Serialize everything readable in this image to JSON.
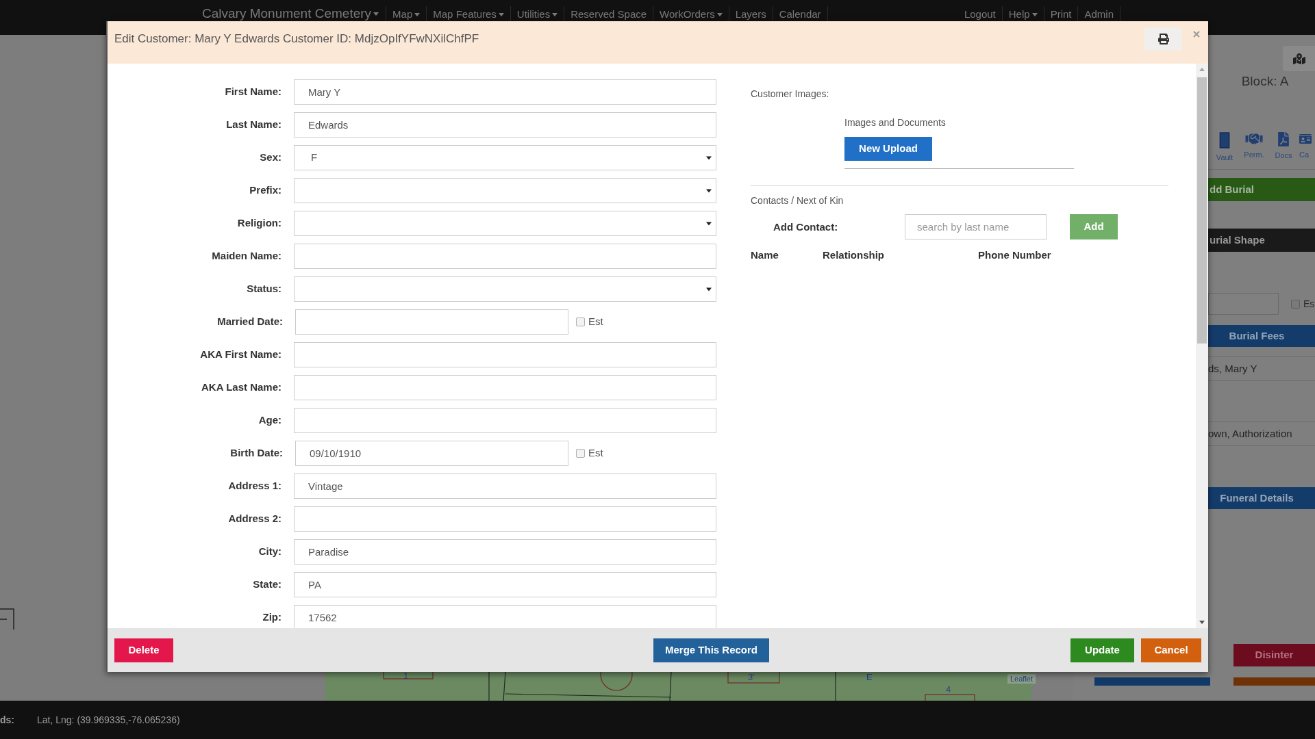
{
  "nav": {
    "brand": {
      "label": "Calvary Monument Cemetery",
      "caret": true
    },
    "items": [
      {
        "label": "Map",
        "caret": true
      },
      {
        "label": "Map Features",
        "caret": true
      },
      {
        "label": "Utilities",
        "caret": true
      },
      {
        "label": "Reserved Space",
        "caret": false
      },
      {
        "label": "WorkOrders",
        "caret": true
      },
      {
        "label": "Layers",
        "caret": false
      },
      {
        "label": "Calendar",
        "caret": false
      }
    ],
    "right_items": [
      {
        "label": "Logout",
        "caret": false
      },
      {
        "label": "Help",
        "caret": true
      },
      {
        "label": "Print",
        "caret": false
      },
      {
        "label": "Admin",
        "caret": false
      }
    ]
  },
  "modal": {
    "title": "Edit Customer: Mary Y Edwards Customer ID: MdjzOpIfYFwNXilChfPF",
    "fields": [
      {
        "kind": "text",
        "label": "First Name:",
        "value": "Mary Y"
      },
      {
        "kind": "text",
        "label": "Last Name:",
        "value": "Edwards"
      },
      {
        "kind": "select",
        "label": "Sex:",
        "value": "F"
      },
      {
        "kind": "select",
        "label": "Prefix:"
      },
      {
        "kind": "select",
        "label": "Religion:"
      },
      {
        "kind": "text",
        "label": "Maiden Name:"
      },
      {
        "kind": "select",
        "label": "Status:"
      },
      {
        "kind": "date",
        "label": "Married Date:",
        "est": {
          "label": "Est",
          "checked": false
        }
      },
      {
        "kind": "text",
        "label": "AKA First Name:"
      },
      {
        "kind": "text",
        "label": "AKA Last Name:"
      },
      {
        "kind": "text",
        "label": "Age:"
      },
      {
        "kind": "date",
        "label": "Birth Date:",
        "value": "09/10/1910",
        "est": {
          "label": "Est",
          "checked": false
        }
      },
      {
        "kind": "text",
        "label": "Address 1:",
        "value": "Vintage"
      },
      {
        "kind": "text",
        "label": "Address 2:"
      },
      {
        "kind": "text",
        "label": "City:",
        "value": "Paradise"
      },
      {
        "kind": "text",
        "label": "State:",
        "value": "PA"
      },
      {
        "kind": "text",
        "label": "Zip:",
        "value": "17562"
      }
    ],
    "images": {
      "title": "Customer Images:",
      "subtitle": "Images and Documents",
      "button": "New Upload"
    },
    "contacts": {
      "title": "Contacts / Next of Kin",
      "add_label": "Add Contact:",
      "search": {
        "placeholder": "search by last name"
      },
      "add_button": "Add",
      "columns": [
        "Name",
        "Relationship",
        "Phone Number"
      ]
    },
    "footer": {
      "delete": "Delete",
      "merge": "Merge This Record",
      "update": "Update",
      "cancel": "Cancel"
    }
  },
  "side_panel": {
    "block_label": "Block: A",
    "tools": [
      {
        "label": "Vault"
      },
      {
        "label": "Perm."
      },
      {
        "label": "Docs"
      },
      {
        "label": "Ca"
      }
    ],
    "rows": [
      {
        "kind": "action",
        "label": "dd Burial"
      },
      {
        "kind": "header",
        "label": "urial Shape"
      },
      {
        "kind": "input",
        "check": {
          "label": "Es",
          "checked": false
        }
      },
      {
        "kind": "section",
        "label": "Burial Fees"
      },
      {
        "kind": "text",
        "label": "ds, Mary Y"
      },
      {
        "kind": "text",
        "label": "own, Authorization"
      },
      {
        "kind": "section",
        "label": "Funeral Details"
      }
    ],
    "disinter_button": "Disinter"
  },
  "map": {
    "labels": [
      "1",
      "3'",
      "E",
      "4"
    ],
    "attribution": "Leaflet"
  },
  "status_bar": {
    "label": "ds:",
    "coords": "Lat, Lng: (39.969335,-76.065236)"
  }
}
